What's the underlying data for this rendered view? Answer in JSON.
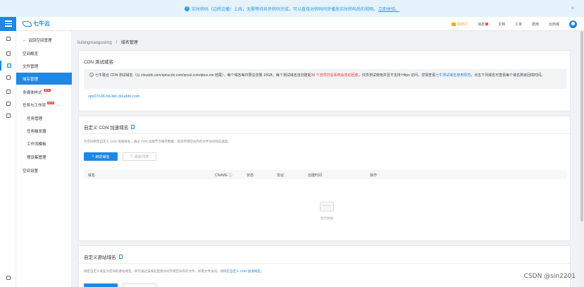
{
  "banner": {
    "text": "实时转码（边转边播）上线，无需等待异步转码完成，可以直接对转码同步播放实时转码后的视频。",
    "link": "立即体验。",
    "info_glyph": "i",
    "close_glyph": "×"
  },
  "header": {
    "logo_text": "七牛云",
    "new_user": "新用户",
    "message": "消息",
    "message_badge": "1",
    "docs": "文档",
    "ticket": "工单",
    "billing": "费用",
    "console": "云商城"
  },
  "sidebar": {
    "back": "返回空间管理",
    "items": [
      {
        "label": "空间概览"
      },
      {
        "label": "文件管理"
      },
      {
        "label": "域名管理"
      },
      {
        "label": "多媒体样式",
        "badge": "NEW"
      },
      {
        "label": "任务与工作流",
        "badge": "NEW"
      },
      {
        "label": "任务管理"
      },
      {
        "label": "任务触发器"
      },
      {
        "label": "工作流模板"
      },
      {
        "label": "预设集管理"
      },
      {
        "label": "空间设置"
      }
    ]
  },
  "breadcrumb": {
    "bucket": "liulangmaogouimg",
    "separator": "/",
    "current": "域名管理"
  },
  "cdn_test": {
    "title": "CDN 测试域名",
    "notice_a": "七牛融合 CDN 测试域名（以 clouddn.com/qiniucdn.com/qnssl.com/qbox.me 结尾），每个域名每日限总流量 10GB，每个测试域名自创建起",
    "notice_red": "30 个自然日后系统会自动回收",
    "notice_b": "，仅供测试使用并且不支持 Https 访问，详情查看",
    "notice_link": "七牛测试域名使用规范",
    "notice_c": "。点击下列域名可查看每个域名剩余回收时间。",
    "domain": "spx07o36.hb-bkt.clouddn.com"
  },
  "custom_cdn": {
    "title": "自定义 CDN 加速域名",
    "desc": "为空间绑定自定义 CDN 加速域名，通过 CDN 边缘节点缓存数据，提高存储空间内的文件访问响应速度。",
    "bind_button": "绑定域名",
    "refresh_button": "刷新列表",
    "columns": [
      "域名",
      "CNAME ⓘ",
      "状态",
      "协议",
      "创建时间",
      "操作"
    ],
    "empty_text": "暂无数据"
  },
  "custom_source": {
    "title": "自定义源站域名",
    "desc_a": "绑定自定义域名为空间的源站域名，即可通过该域名直接访问存储空间内的文件。如需文件访问，请绑定",
    "desc_link": "自定义 CDN 加速域名",
    "desc_b": "。"
  },
  "watermark": "CSDN @sin2201"
}
